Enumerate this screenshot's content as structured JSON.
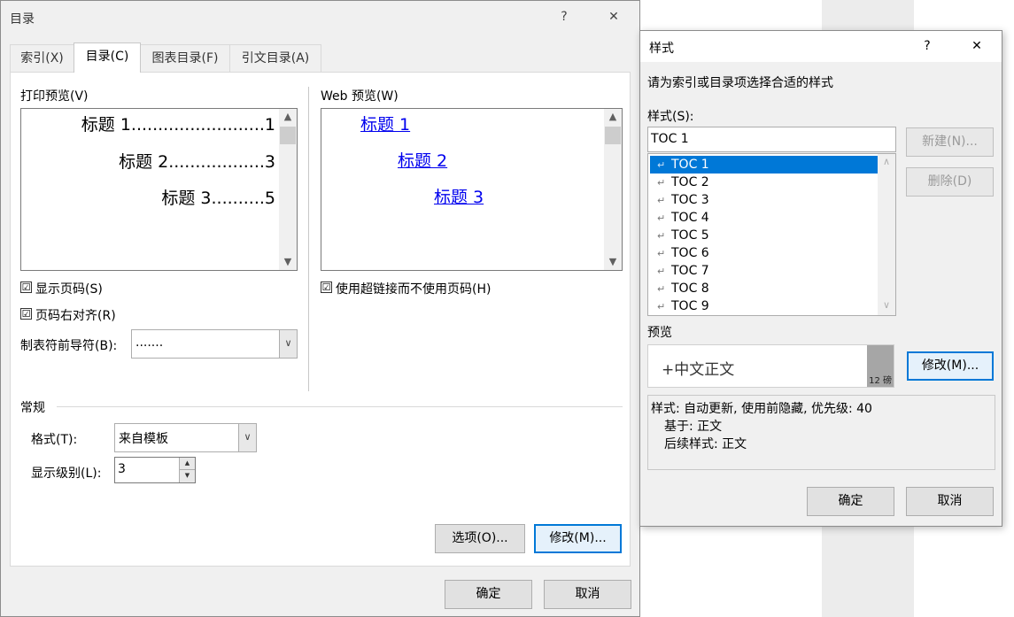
{
  "toc_dialog": {
    "title": "目录",
    "help": "?",
    "close": "✕",
    "tabs": [
      {
        "label": "索引(X)"
      },
      {
        "label": "目录(C)"
      },
      {
        "label": "图表目录(F)"
      },
      {
        "label": "引文目录(A)"
      }
    ],
    "print_preview": {
      "label": "打印预览(V)",
      "lines": [
        {
          "text": "标题 1.........................1"
        },
        {
          "text": "标题 2..................3"
        },
        {
          "text": "标题 3..........5"
        }
      ]
    },
    "web_preview": {
      "label": "Web 预览(W)",
      "links": [
        {
          "text": "标题 1"
        },
        {
          "text": "标题 2"
        },
        {
          "text": "标题 3"
        }
      ]
    },
    "show_page_numbers": {
      "label": "显示页码(S)",
      "checked": "☑"
    },
    "right_align": {
      "label": "页码右对齐(R)",
      "checked": "☑"
    },
    "use_hyperlinks": {
      "label": "使用超链接而不使用页码(H)",
      "checked": "☑"
    },
    "tab_leader": {
      "label": "制表符前导符(B):",
      "value": "......."
    },
    "general": {
      "label": "常规",
      "format_label": "格式(T):",
      "format_value": "来自模板",
      "levels_label": "显示级别(L):",
      "levels_value": "3"
    },
    "options_button": "选项(O)...",
    "modify_button": "修改(M)...",
    "ok_button": "确定",
    "cancel_button": "取消"
  },
  "style_dialog": {
    "title": "样式",
    "help": "?",
    "close": "✕",
    "instruction": "请为索引或目录项选择合适的样式",
    "styles_label": "样式(S):",
    "style_input": "TOC 1",
    "styles": [
      {
        "name": "TOC 1"
      },
      {
        "name": "TOC 2"
      },
      {
        "name": "TOC 3"
      },
      {
        "name": "TOC 4"
      },
      {
        "name": "TOC 5"
      },
      {
        "name": "TOC 6"
      },
      {
        "name": "TOC 7"
      },
      {
        "name": "TOC 8"
      },
      {
        "name": "TOC 9"
      }
    ],
    "return_glyph": "↵",
    "new_button": "新建(N)...",
    "delete_button": "删除(D)",
    "preview_label": "预览",
    "preview_text": "+中文正文",
    "preview_size": "12 磅",
    "modify_button": "修改(M)...",
    "description": [
      {
        "text": "样式: 自动更新, 使用前隐藏, 优先级: 40"
      },
      {
        "text": "基于: 正文"
      },
      {
        "text": "后续样式: 正文"
      }
    ],
    "ok_button": "确定",
    "cancel_button": "取消"
  },
  "colors": {
    "accent": "#0078d7",
    "link": "#0000ee",
    "dialog_bg": "#f0f0f0"
  },
  "icons": {
    "scroll_up": "chevron-up-icon",
    "scroll_down": "chevron-down-icon",
    "dropdown": "chevron-down-icon",
    "checkbox": "checkbox-checked-icon"
  }
}
